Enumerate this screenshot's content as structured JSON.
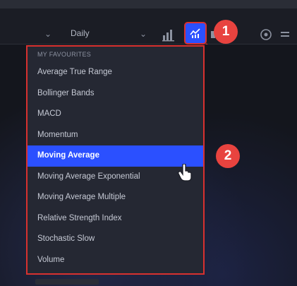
{
  "toolbar": {
    "period_label": "Daily"
  },
  "annotations": {
    "step1": "1",
    "step2": "2"
  },
  "indicator_menu": {
    "section_header": "MY FAVOURITES",
    "items": [
      {
        "label": "Average True Range"
      },
      {
        "label": "Bollinger Bands"
      },
      {
        "label": "MACD"
      },
      {
        "label": "Momentum"
      },
      {
        "label": "Moving Average",
        "selected": true
      },
      {
        "label": "Moving Average Exponential"
      },
      {
        "label": "Moving Average Multiple"
      },
      {
        "label": "Relative Strength Index"
      },
      {
        "label": "Stochastic Slow"
      },
      {
        "label": "Volume"
      }
    ]
  },
  "colors": {
    "accent": "#2b50ff",
    "highlight_border": "#d8312f",
    "badge": "#e8433f",
    "menu_bg": "#252833"
  },
  "icons": [
    "chevron-down-icon",
    "bar-chart-icon",
    "indicators-icon",
    "settings-icon",
    "hand-pointer-icon"
  ]
}
